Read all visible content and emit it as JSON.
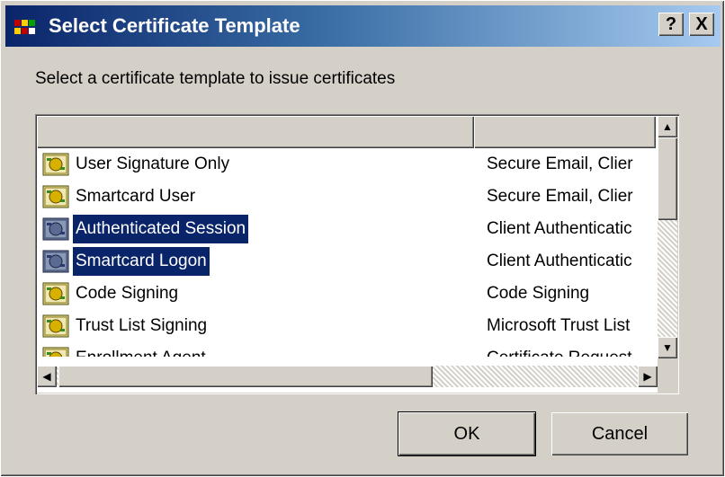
{
  "window": {
    "title": "Select Certificate Template",
    "help_label": "?",
    "close_label": "X"
  },
  "prompt": "Select a certificate template to issue certificates",
  "list": {
    "columns": [
      "",
      ""
    ],
    "rows": [
      {
        "name": "User Signature Only",
        "purpose": "Secure Email, Clier",
        "selected": false
      },
      {
        "name": "Smartcard User",
        "purpose": "Secure Email, Clier",
        "selected": false
      },
      {
        "name": "Authenticated Session",
        "purpose": "Client Authenticatic",
        "selected": true
      },
      {
        "name": "Smartcard Logon",
        "purpose": "Client Authenticatic",
        "selected": true
      },
      {
        "name": "Code Signing",
        "purpose": "Code Signing",
        "selected": false
      },
      {
        "name": "Trust List Signing",
        "purpose": "Microsoft Trust List",
        "selected": false
      },
      {
        "name": "Enrollment Agent",
        "purpose": "Certificate Request",
        "selected": false
      }
    ]
  },
  "buttons": {
    "ok": "OK",
    "cancel": "Cancel"
  },
  "colors": {
    "selection": "#0a246a",
    "dialog_face": "#d4d0c8"
  }
}
